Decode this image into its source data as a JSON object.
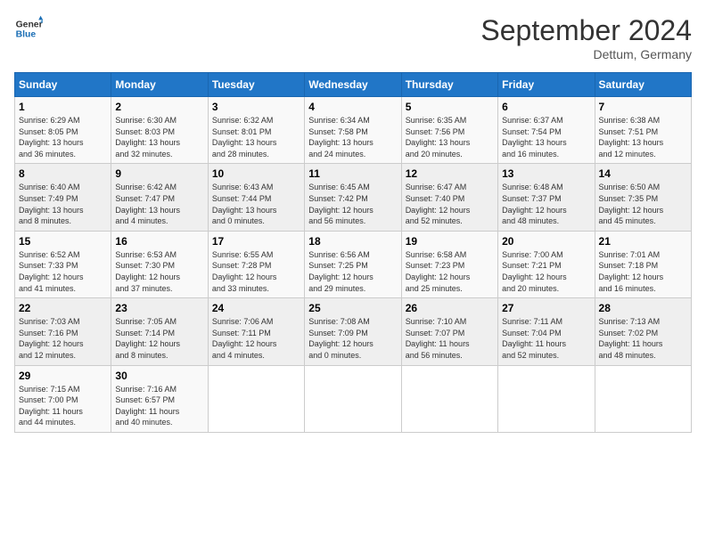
{
  "header": {
    "logo_line1": "General",
    "logo_line2": "Blue",
    "month": "September 2024",
    "location": "Dettum, Germany"
  },
  "days_of_week": [
    "Sunday",
    "Monday",
    "Tuesday",
    "Wednesday",
    "Thursday",
    "Friday",
    "Saturday"
  ],
  "weeks": [
    [
      {
        "day": 1,
        "sunrise": "6:29 AM",
        "sunset": "8:05 PM",
        "daylight": "13 hours and 36 minutes."
      },
      {
        "day": 2,
        "sunrise": "6:30 AM",
        "sunset": "8:03 PM",
        "daylight": "13 hours and 32 minutes."
      },
      {
        "day": 3,
        "sunrise": "6:32 AM",
        "sunset": "8:01 PM",
        "daylight": "13 hours and 28 minutes."
      },
      {
        "day": 4,
        "sunrise": "6:34 AM",
        "sunset": "7:58 PM",
        "daylight": "13 hours and 24 minutes."
      },
      {
        "day": 5,
        "sunrise": "6:35 AM",
        "sunset": "7:56 PM",
        "daylight": "13 hours and 20 minutes."
      },
      {
        "day": 6,
        "sunrise": "6:37 AM",
        "sunset": "7:54 PM",
        "daylight": "13 hours and 16 minutes."
      },
      {
        "day": 7,
        "sunrise": "6:38 AM",
        "sunset": "7:51 PM",
        "daylight": "13 hours and 12 minutes."
      }
    ],
    [
      {
        "day": 8,
        "sunrise": "6:40 AM",
        "sunset": "7:49 PM",
        "daylight": "13 hours and 8 minutes."
      },
      {
        "day": 9,
        "sunrise": "6:42 AM",
        "sunset": "7:47 PM",
        "daylight": "13 hours and 4 minutes."
      },
      {
        "day": 10,
        "sunrise": "6:43 AM",
        "sunset": "7:44 PM",
        "daylight": "13 hours and 0 minutes."
      },
      {
        "day": 11,
        "sunrise": "6:45 AM",
        "sunset": "7:42 PM",
        "daylight": "12 hours and 56 minutes."
      },
      {
        "day": 12,
        "sunrise": "6:47 AM",
        "sunset": "7:40 PM",
        "daylight": "12 hours and 52 minutes."
      },
      {
        "day": 13,
        "sunrise": "6:48 AM",
        "sunset": "7:37 PM",
        "daylight": "12 hours and 48 minutes."
      },
      {
        "day": 14,
        "sunrise": "6:50 AM",
        "sunset": "7:35 PM",
        "daylight": "12 hours and 45 minutes."
      }
    ],
    [
      {
        "day": 15,
        "sunrise": "6:52 AM",
        "sunset": "7:33 PM",
        "daylight": "12 hours and 41 minutes."
      },
      {
        "day": 16,
        "sunrise": "6:53 AM",
        "sunset": "7:30 PM",
        "daylight": "12 hours and 37 minutes."
      },
      {
        "day": 17,
        "sunrise": "6:55 AM",
        "sunset": "7:28 PM",
        "daylight": "12 hours and 33 minutes."
      },
      {
        "day": 18,
        "sunrise": "6:56 AM",
        "sunset": "7:25 PM",
        "daylight": "12 hours and 29 minutes."
      },
      {
        "day": 19,
        "sunrise": "6:58 AM",
        "sunset": "7:23 PM",
        "daylight": "12 hours and 25 minutes."
      },
      {
        "day": 20,
        "sunrise": "7:00 AM",
        "sunset": "7:21 PM",
        "daylight": "12 hours and 20 minutes."
      },
      {
        "day": 21,
        "sunrise": "7:01 AM",
        "sunset": "7:18 PM",
        "daylight": "12 hours and 16 minutes."
      }
    ],
    [
      {
        "day": 22,
        "sunrise": "7:03 AM",
        "sunset": "7:16 PM",
        "daylight": "12 hours and 12 minutes."
      },
      {
        "day": 23,
        "sunrise": "7:05 AM",
        "sunset": "7:14 PM",
        "daylight": "12 hours and 8 minutes."
      },
      {
        "day": 24,
        "sunrise": "7:06 AM",
        "sunset": "7:11 PM",
        "daylight": "12 hours and 4 minutes."
      },
      {
        "day": 25,
        "sunrise": "7:08 AM",
        "sunset": "7:09 PM",
        "daylight": "12 hours and 0 minutes."
      },
      {
        "day": 26,
        "sunrise": "7:10 AM",
        "sunset": "7:07 PM",
        "daylight": "11 hours and 56 minutes."
      },
      {
        "day": 27,
        "sunrise": "7:11 AM",
        "sunset": "7:04 PM",
        "daylight": "11 hours and 52 minutes."
      },
      {
        "day": 28,
        "sunrise": "7:13 AM",
        "sunset": "7:02 PM",
        "daylight": "11 hours and 48 minutes."
      }
    ],
    [
      {
        "day": 29,
        "sunrise": "7:15 AM",
        "sunset": "7:00 PM",
        "daylight": "11 hours and 44 minutes."
      },
      {
        "day": 30,
        "sunrise": "7:16 AM",
        "sunset": "6:57 PM",
        "daylight": "11 hours and 40 minutes."
      },
      null,
      null,
      null,
      null,
      null
    ]
  ]
}
